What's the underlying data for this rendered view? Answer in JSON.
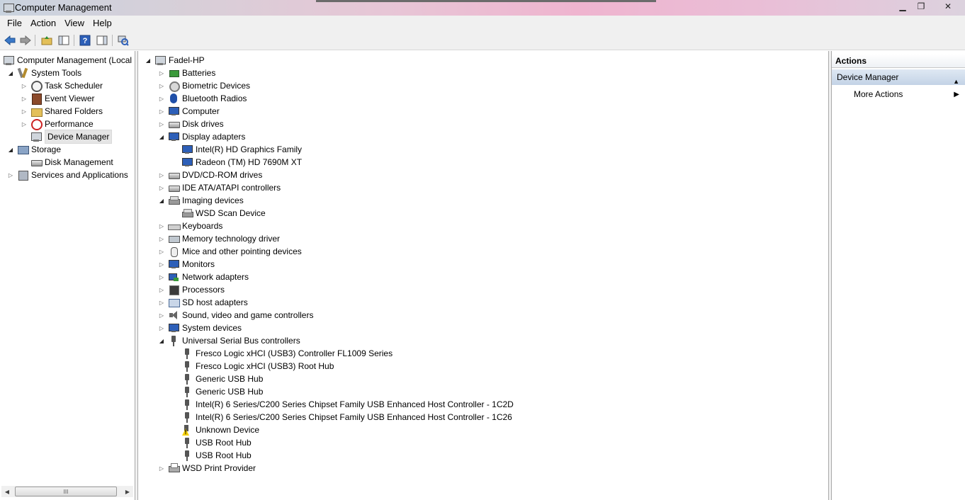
{
  "window": {
    "title": "Computer Management",
    "min_glyph": "▁",
    "max_glyph": "❐",
    "close_glyph": "✕"
  },
  "menu": [
    "File",
    "Action",
    "View",
    "Help"
  ],
  "left_tree": {
    "root": "Computer Management (Local",
    "items": [
      {
        "label": "System Tools",
        "level": 1,
        "expander": "open",
        "icon": "tools"
      },
      {
        "label": "Task Scheduler",
        "level": 2,
        "expander": "closed",
        "icon": "clock"
      },
      {
        "label": "Event Viewer",
        "level": 2,
        "expander": "closed",
        "icon": "book"
      },
      {
        "label": "Shared Folders",
        "level": 2,
        "expander": "closed",
        "icon": "folder"
      },
      {
        "label": "Performance",
        "level": 2,
        "expander": "closed",
        "icon": "noentry"
      },
      {
        "label": "Device Manager",
        "level": 2,
        "expander": "none",
        "icon": "computer",
        "selected": true
      },
      {
        "label": "Storage",
        "level": 1,
        "expander": "open",
        "icon": "storage"
      },
      {
        "label": "Disk Management",
        "level": 2,
        "expander": "none",
        "icon": "drive"
      },
      {
        "label": "Services and Applications",
        "level": 1,
        "expander": "closed",
        "icon": "services"
      }
    ]
  },
  "device_tree": {
    "root": "Fadel-HP",
    "items": [
      {
        "label": "Batteries",
        "level": 1,
        "expander": "closed",
        "icon": "battery"
      },
      {
        "label": "Biometric Devices",
        "level": 1,
        "expander": "closed",
        "icon": "gear"
      },
      {
        "label": "Bluetooth Radios",
        "level": 1,
        "expander": "closed",
        "icon": "bt"
      },
      {
        "label": "Computer",
        "level": 1,
        "expander": "closed",
        "icon": "monitor"
      },
      {
        "label": "Disk drives",
        "level": 1,
        "expander": "closed",
        "icon": "drive"
      },
      {
        "label": "Display adapters",
        "level": 1,
        "expander": "open",
        "icon": "monitor"
      },
      {
        "label": "Intel(R) HD Graphics Family",
        "level": 2,
        "expander": "none",
        "icon": "monitor"
      },
      {
        "label": "Radeon (TM) HD 7690M XT",
        "level": 2,
        "expander": "none",
        "icon": "monitor"
      },
      {
        "label": "DVD/CD-ROM drives",
        "level": 1,
        "expander": "closed",
        "icon": "drive"
      },
      {
        "label": "IDE ATA/ATAPI controllers",
        "level": 1,
        "expander": "closed",
        "icon": "drive"
      },
      {
        "label": "Imaging devices",
        "level": 1,
        "expander": "open",
        "icon": "scanner"
      },
      {
        "label": "WSD Scan Device",
        "level": 2,
        "expander": "none",
        "icon": "scanner"
      },
      {
        "label": "Keyboards",
        "level": 1,
        "expander": "closed",
        "icon": "kbd"
      },
      {
        "label": "Memory technology driver",
        "level": 1,
        "expander": "closed",
        "icon": "mem"
      },
      {
        "label": "Mice and other pointing devices",
        "level": 1,
        "expander": "closed",
        "icon": "mouse"
      },
      {
        "label": "Monitors",
        "level": 1,
        "expander": "closed",
        "icon": "monitor"
      },
      {
        "label": "Network adapters",
        "level": 1,
        "expander": "closed",
        "icon": "net"
      },
      {
        "label": "Processors",
        "level": 1,
        "expander": "closed",
        "icon": "chip"
      },
      {
        "label": "SD host adapters",
        "level": 1,
        "expander": "closed",
        "icon": "sd"
      },
      {
        "label": "Sound, video and game controllers",
        "level": 1,
        "expander": "closed",
        "icon": "sound"
      },
      {
        "label": "System devices",
        "level": 1,
        "expander": "closed",
        "icon": "monitor"
      },
      {
        "label": "Universal Serial Bus controllers",
        "level": 1,
        "expander": "open",
        "icon": "usb"
      },
      {
        "label": "Fresco Logic xHCI (USB3) Controller FL1009 Series",
        "level": 2,
        "expander": "none",
        "icon": "usb"
      },
      {
        "label": "Fresco Logic xHCI (USB3) Root Hub",
        "level": 2,
        "expander": "none",
        "icon": "usb"
      },
      {
        "label": "Generic USB Hub",
        "level": 2,
        "expander": "none",
        "icon": "usb"
      },
      {
        "label": "Generic USB Hub",
        "level": 2,
        "expander": "none",
        "icon": "usb"
      },
      {
        "label": "Intel(R) 6 Series/C200 Series Chipset Family USB Enhanced Host Controller - 1C2D",
        "level": 2,
        "expander": "none",
        "icon": "usb"
      },
      {
        "label": "Intel(R) 6 Series/C200 Series Chipset Family USB Enhanced Host Controller - 1C26",
        "level": 2,
        "expander": "none",
        "icon": "usb"
      },
      {
        "label": "Unknown Device",
        "level": 2,
        "expander": "none",
        "icon": "warn"
      },
      {
        "label": "USB Root Hub",
        "level": 2,
        "expander": "none",
        "icon": "usb"
      },
      {
        "label": "USB Root Hub",
        "level": 2,
        "expander": "none",
        "icon": "usb"
      },
      {
        "label": "WSD Print Provider",
        "level": 1,
        "expander": "closed",
        "icon": "printer"
      }
    ]
  },
  "actions": {
    "header": "Actions",
    "section": "Device Manager",
    "items": [
      "More Actions"
    ]
  },
  "scrollbar": {
    "grip": "III"
  }
}
